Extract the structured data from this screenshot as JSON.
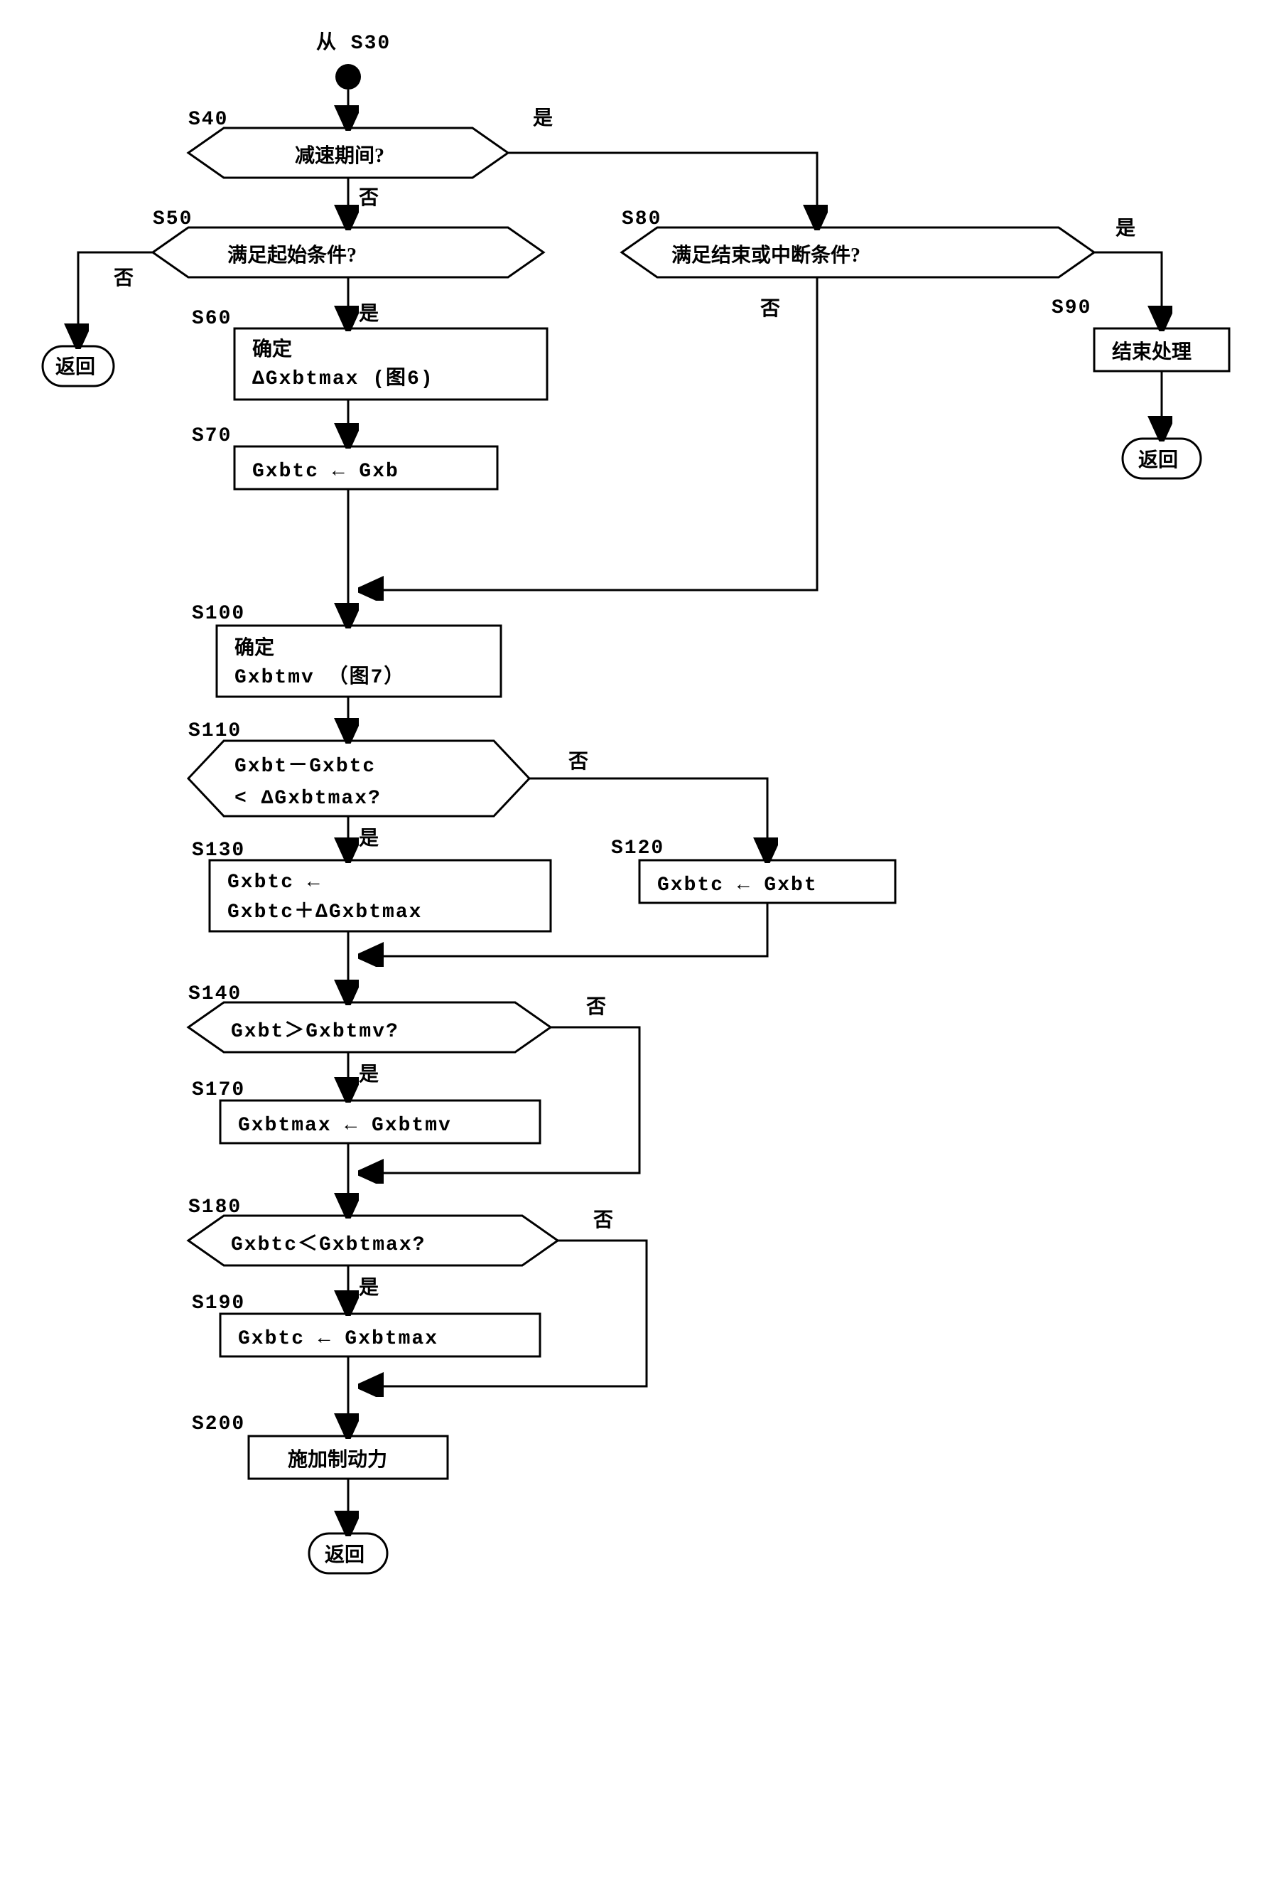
{
  "entry": {
    "label": "从 S30",
    "id": "S30"
  },
  "nodes": {
    "s40": {
      "id": "S40",
      "text": "减速期间?",
      "yes": "是",
      "no": "否"
    },
    "s50": {
      "id": "S50",
      "text": "满足起始条件?",
      "yes": "是",
      "no": "否"
    },
    "s60": {
      "id": "S60",
      "line1": "确定",
      "line2": "ΔGxbtmax (图6)"
    },
    "s70": {
      "id": "S70",
      "text": "Gxbtc ← Gxb"
    },
    "s80": {
      "id": "S80",
      "text": "满足结束或中断条件?",
      "yes": "是",
      "no": "否"
    },
    "s90": {
      "id": "S90",
      "text": "结束处理"
    },
    "s100": {
      "id": "S100",
      "line1": "确定",
      "line2": "Gxbtmv （图7）"
    },
    "s110": {
      "id": "S110",
      "line1": "Gxbt－Gxbtc",
      "line2": "< ΔGxbtmax?",
      "yes": "是",
      "no": "否"
    },
    "s120": {
      "id": "S120",
      "text": "Gxbtc ← Gxbt"
    },
    "s130": {
      "id": "S130",
      "line1": "Gxbtc ←",
      "line2": " Gxbtc＋ΔGxbtmax"
    },
    "s140": {
      "id": "S140",
      "text": "Gxbt＞Gxbtmv?",
      "yes": "是",
      "no": "否"
    },
    "s170": {
      "id": "S170",
      "text": "Gxbtmax ← Gxbtmv"
    },
    "s180": {
      "id": "S180",
      "text": "Gxbtc＜Gxbtmax?",
      "yes": "是",
      "no": "否"
    },
    "s190": {
      "id": "S190",
      "text": "Gxbtc ← Gxbtmax"
    },
    "s200": {
      "id": "S200",
      "text": "施加制动力"
    }
  },
  "terminals": {
    "return": "返回"
  }
}
